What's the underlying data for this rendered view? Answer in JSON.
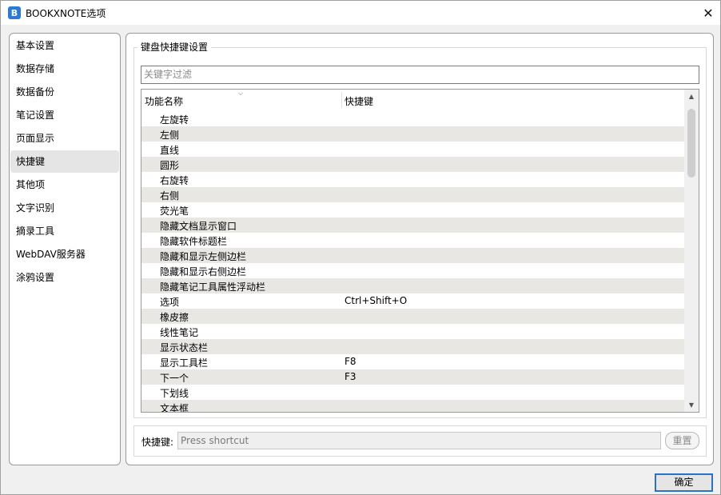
{
  "window": {
    "title": "BOOKXNOTE选项",
    "app_icon_letter": "B",
    "close_glyph": "✕"
  },
  "sidebar": {
    "items": [
      {
        "label": "基本设置"
      },
      {
        "label": "数据存储"
      },
      {
        "label": "数据备份"
      },
      {
        "label": "笔记设置"
      },
      {
        "label": "页面显示"
      },
      {
        "label": "快捷键",
        "active": true
      },
      {
        "label": "其他项"
      },
      {
        "label": "文字识别"
      },
      {
        "label": "摘录工具"
      },
      {
        "label": "WebDAV服务器"
      },
      {
        "label": "涂鸦设置"
      }
    ]
  },
  "shortcuts": {
    "group_title": "键盘快捷键设置",
    "filter_placeholder": "关键字过滤",
    "columns": {
      "name": "功能名称",
      "key": "快捷键"
    },
    "rows": [
      {
        "name": "左旋转",
        "key": ""
      },
      {
        "name": "左侧",
        "key": ""
      },
      {
        "name": "直线",
        "key": ""
      },
      {
        "name": "圆形",
        "key": ""
      },
      {
        "name": "右旋转",
        "key": ""
      },
      {
        "name": "右侧",
        "key": ""
      },
      {
        "name": "荧光笔",
        "key": ""
      },
      {
        "name": "隐藏文档显示窗口",
        "key": ""
      },
      {
        "name": "隐藏软件标题栏",
        "key": ""
      },
      {
        "name": "隐藏和显示左侧边栏",
        "key": ""
      },
      {
        "name": "隐藏和显示右侧边栏",
        "key": ""
      },
      {
        "name": "隐藏笔记工具属性浮动栏",
        "key": ""
      },
      {
        "name": "选项",
        "key": "Ctrl+Shift+O"
      },
      {
        "name": "橡皮擦",
        "key": ""
      },
      {
        "name": "线性笔记",
        "key": ""
      },
      {
        "name": "显示状态栏",
        "key": ""
      },
      {
        "name": "显示工具栏",
        "key": "F8"
      },
      {
        "name": "下一个",
        "key": "F3"
      },
      {
        "name": "下划线",
        "key": ""
      },
      {
        "name": "文本框",
        "key": ""
      }
    ],
    "shortcut_label": "快捷键:",
    "shortcut_placeholder": "Press shortcut",
    "reset_label": "重置"
  },
  "footer": {
    "ok_label": "确定"
  }
}
